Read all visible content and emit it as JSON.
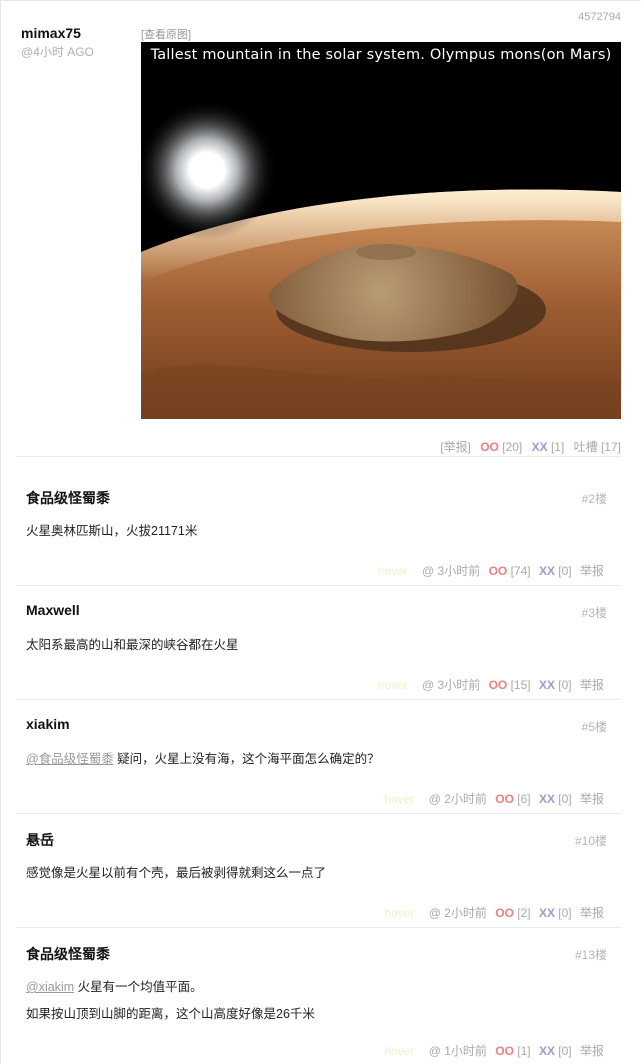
{
  "post": {
    "author": "mimax75",
    "time": "@4小时 AGO",
    "id": "4572794",
    "view_original": "[查看原图]",
    "image_caption": "Tallest mountain in the solar system. Olympus mons(on Mars)",
    "report": "[举报]",
    "oo_label": "OO",
    "oo_count": "[20]",
    "xx_label": "XX",
    "xx_count": "[1]",
    "tucao": "吐槽 [17]"
  },
  "comments": [
    {
      "author": "食品级怪蜀黍",
      "floor": "#2楼",
      "lines": [
        "火星奥林匹斯山，火拔21171米"
      ],
      "ghost": "hover",
      "time": "@ 3小时前",
      "oo_label": "OO",
      "oo_count": "[74]",
      "xx_label": "XX",
      "xx_count": "[0]",
      "report": "举报"
    },
    {
      "author": "Maxwell",
      "floor": "#3楼",
      "lines": [
        "太阳系最高的山和最深的峡谷都在火星"
      ],
      "ghost": "hover",
      "time": "@ 3小时前",
      "oo_label": "OO",
      "oo_count": "[15]",
      "xx_label": "XX",
      "xx_count": "[0]",
      "report": "举报"
    },
    {
      "author": "xiakim",
      "floor": "#5楼",
      "mention": "@食品级怪蜀黍",
      "lines": [
        " 疑问，火星上没有海，这个海平面怎么确定的？"
      ],
      "ghost": "hover",
      "time": "@ 2小时前",
      "oo_label": "OO",
      "oo_count": "[6]",
      "xx_label": "XX",
      "xx_count": "[0]",
      "report": "举报"
    },
    {
      "author": "悬岳",
      "floor": "#10楼",
      "lines": [
        "感觉像是火星以前有个壳，最后被剥得就剩这么一点了"
      ],
      "ghost": "hover",
      "time": "@ 2小时前",
      "oo_label": "OO",
      "oo_count": "[2]",
      "xx_label": "XX",
      "xx_count": "[0]",
      "report": "举报"
    },
    {
      "author": "食品级怪蜀黍",
      "floor": "#13楼",
      "mention": "@xiakim",
      "lines": [
        " 火星有一个均值平面。",
        "如果按山顶到山脚的距离，这个山高度好像是26千米"
      ],
      "ghost": "hover",
      "time": "@ 1小时前",
      "oo_label": "OO",
      "oo_count": "[1]",
      "xx_label": "XX",
      "xx_count": "[0]",
      "report": "举报"
    }
  ]
}
